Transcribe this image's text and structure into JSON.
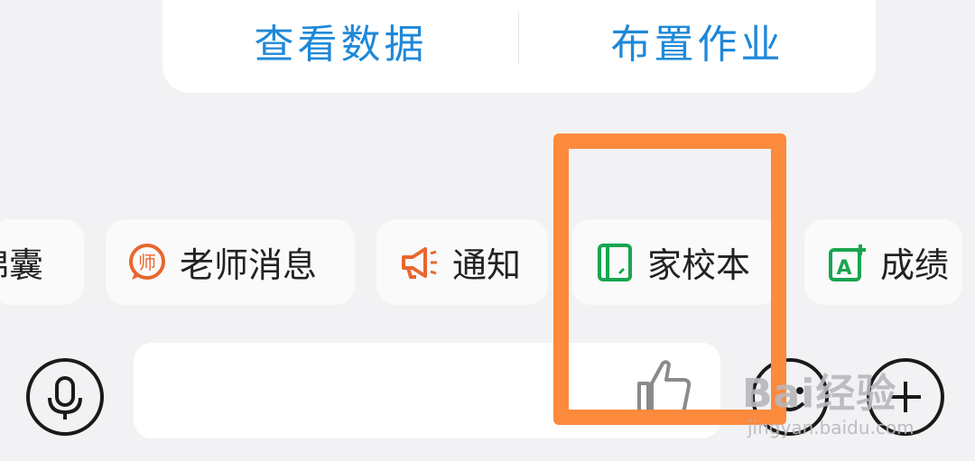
{
  "top_actions": {
    "view_data": "查看数据",
    "assign_homework": "布置作业"
  },
  "shortcuts": [
    {
      "label": "锦囊",
      "icon": "pouch-icon"
    },
    {
      "label": "老师消息",
      "icon": "teacher-message-icon",
      "color": "#e8672e"
    },
    {
      "label": "通知",
      "icon": "megaphone-icon",
      "color": "#e8672e"
    },
    {
      "label": "家校本",
      "icon": "notebook-icon",
      "color": "#19a550"
    },
    {
      "label": "成绩",
      "icon": "grade-icon",
      "color": "#19a550"
    }
  ],
  "input": {
    "placeholder": ""
  },
  "colors": {
    "accent_blue": "#1e88d8",
    "highlight_orange": "#fb8a3c"
  },
  "watermark": {
    "brand": "Bai经验",
    "url": "jingyan.baidu.com"
  }
}
